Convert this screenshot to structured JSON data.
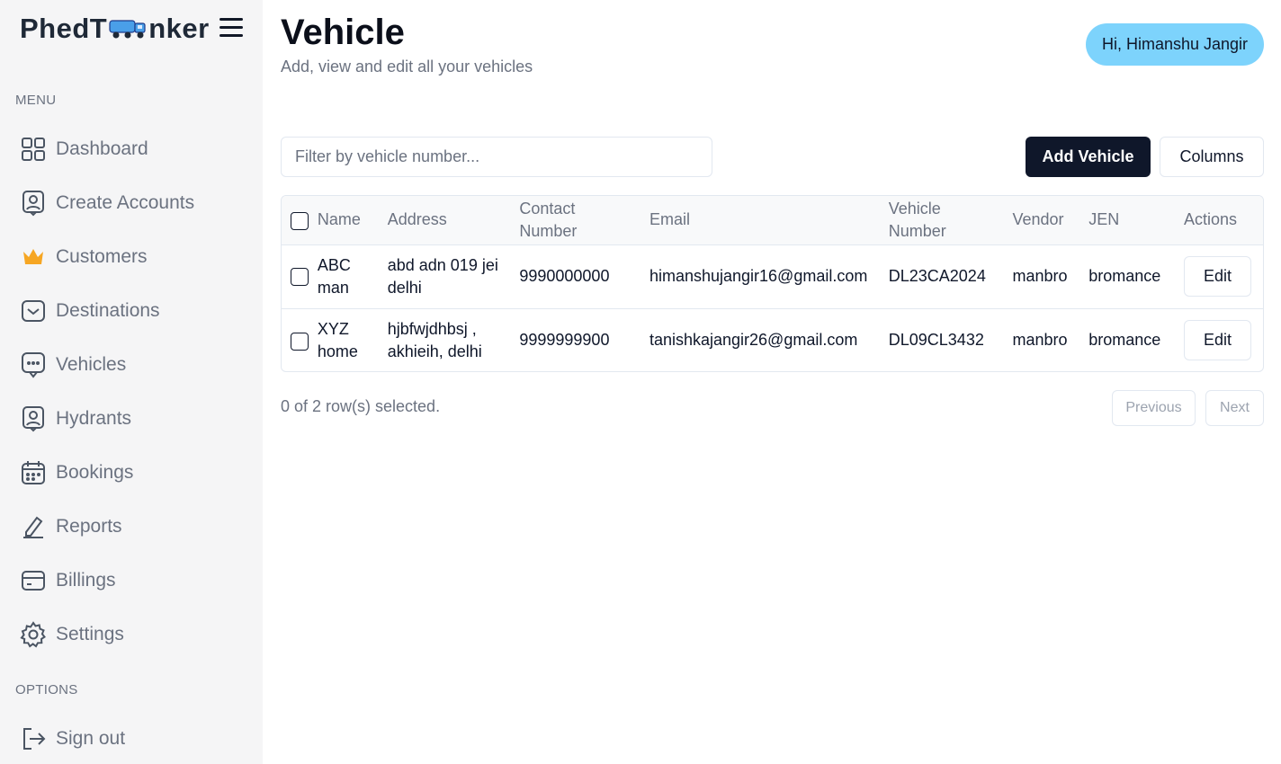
{
  "logo": {
    "left": "PhedT",
    "right": "nker"
  },
  "menu_label": "MENU",
  "options_label": "OPTIONS",
  "nav": [
    {
      "label": "Dashboard",
      "icon": "dashboard-icon"
    },
    {
      "label": "Create Accounts",
      "icon": "user-badge-icon"
    },
    {
      "label": "Customers",
      "icon": "crown-icon"
    },
    {
      "label": "Destinations",
      "icon": "inbox-icon"
    },
    {
      "label": "Vehicles",
      "icon": "chat-icon"
    },
    {
      "label": "Hydrants",
      "icon": "user-badge-icon"
    },
    {
      "label": "Bookings",
      "icon": "calendar-icon"
    },
    {
      "label": "Reports",
      "icon": "pen-icon"
    },
    {
      "label": "Billings",
      "icon": "card-icon"
    },
    {
      "label": "Settings",
      "icon": "gear-icon"
    }
  ],
  "signout": {
    "label": "Sign out",
    "icon": "sign-out-icon"
  },
  "header": {
    "title": "Vehicle",
    "subtitle": "Add, view and edit all your vehicles",
    "greeting": "Hi, Himanshu Jangir"
  },
  "toolbar": {
    "filter_placeholder": "Filter by vehicle number...",
    "add_label": "Add Vehicle",
    "columns_label": "Columns"
  },
  "table": {
    "headers": [
      "Name",
      "Address",
      "Contact Number",
      "Email",
      "Vehicle Number",
      "Vendor",
      "JEN",
      "Actions"
    ],
    "rows": [
      {
        "name": "ABC man",
        "address": "abd adn 019 jei delhi",
        "contact": "9990000000",
        "email": "himanshujangir16@gmail.com",
        "vehicle": "DL23CA2024",
        "vendor": "manbro",
        "jen": "bromance",
        "action": "Edit"
      },
      {
        "name": "XYZ home",
        "address": "hjbfwjdhbsj , akhieih, delhi",
        "contact": "9999999900",
        "email": "tanishkajangir26@gmail.com",
        "vehicle": "DL09CL3432",
        "vendor": "manbro",
        "jen": "bromance",
        "action": "Edit"
      }
    ]
  },
  "footer": {
    "selection": "0 of 2 row(s) selected.",
    "previous": "Previous",
    "next": "Next"
  },
  "colors": {
    "accent": "#7dd3fc",
    "primary": "#0f172a",
    "crown": "#f6a623"
  }
}
